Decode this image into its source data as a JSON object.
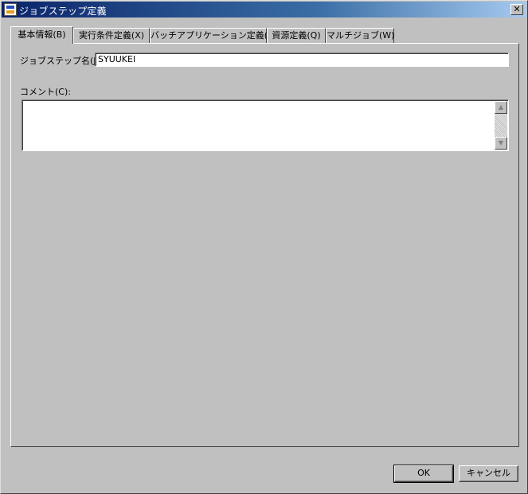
{
  "window": {
    "title": "ジョブステップ定義",
    "close_glyph": "✕"
  },
  "tabs": [
    {
      "label": "基本情報(B)"
    },
    {
      "label": "実行条件定義(X)"
    },
    {
      "label": "バッチアプリケーション定義(T)"
    },
    {
      "label": "資源定義(Q)"
    },
    {
      "label": "マルチジョブ(W)"
    }
  ],
  "basic": {
    "step_name_label": "ジョブステップ名(J):",
    "step_name_value": "SYUUKEI",
    "comment_label": "コメント(C):",
    "comment_value": ""
  },
  "scroll": {
    "up_glyph": "▲",
    "down_glyph": "▼"
  },
  "buttons": {
    "ok": "OK",
    "cancel": "キャンセル"
  }
}
